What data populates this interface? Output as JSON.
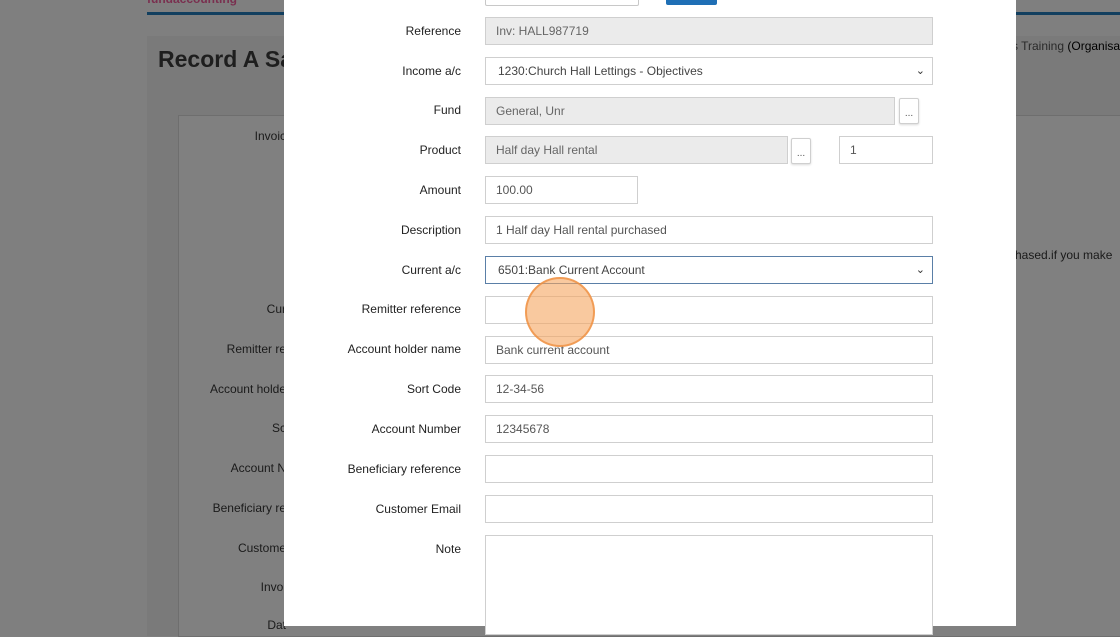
{
  "background": {
    "brand": "fundaccounting",
    "title": "Record A Sa",
    "org_text": "s Training",
    "org_bold": "(Organisat",
    "note": "hased.if you make",
    "labels": [
      "Invoic",
      "Cur",
      "Remitter re",
      "Account holde",
      "Sc",
      "Account N",
      "Beneficiary re",
      "Custome",
      "Invoi",
      "Dat"
    ]
  },
  "form": {
    "reference": {
      "label": "Reference",
      "value": "Inv: HALL987719"
    },
    "income": {
      "label": "Income a/c",
      "value": "1230:Church Hall Lettings - Objectives"
    },
    "fund": {
      "label": "Fund",
      "value": "General, Unr",
      "button": "..."
    },
    "product": {
      "label": "Product",
      "value": "Half day Hall rental",
      "button": "...",
      "quantity": "1"
    },
    "amount": {
      "label": "Amount",
      "value": "100.00"
    },
    "description": {
      "label": "Description",
      "value": "1 Half day Hall rental purchased"
    },
    "current": {
      "label": "Current a/c",
      "value": "6501:Bank Current Account"
    },
    "remitter": {
      "label": "Remitter reference",
      "value": ""
    },
    "holder": {
      "label": "Account holder name",
      "value": "Bank current account"
    },
    "sort_code": {
      "label": "Sort Code",
      "value": "12-34-56"
    },
    "account_number": {
      "label": "Account Number",
      "value": "12345678"
    },
    "beneficiary": {
      "label": "Beneficiary reference",
      "value": ""
    },
    "email": {
      "label": "Customer Email",
      "value": ""
    },
    "note": {
      "label": "Note",
      "value": ""
    }
  },
  "colors": {
    "overlay": "#7f7f7f",
    "primary_button": "#1f6fb5",
    "readonly_field": "#ebebeb",
    "cursor_highlight": "#f5a55f"
  },
  "icons": {
    "select_arrow": "chevron-down-icon"
  }
}
